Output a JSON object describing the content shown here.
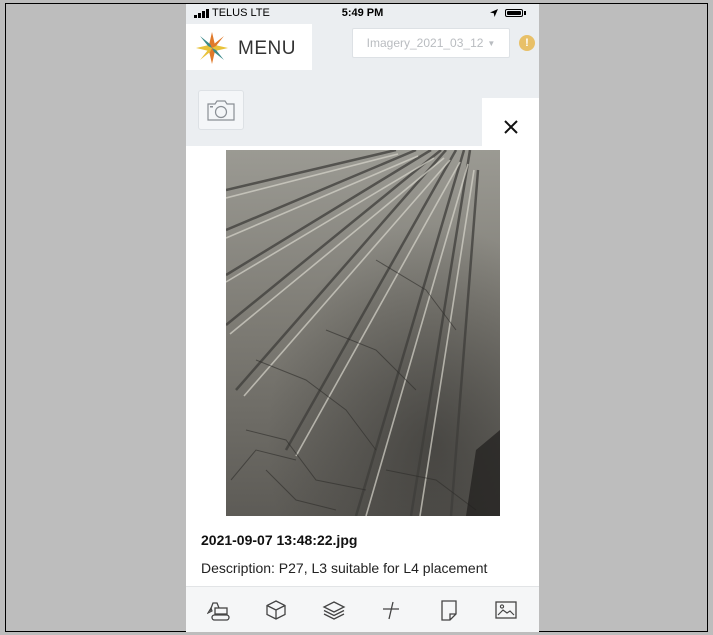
{
  "status_bar": {
    "carrier": "TELUS  LTE",
    "time": "5:49 PM"
  },
  "header": {
    "menu_label": "MENU",
    "imagery_select": "Imagery_2021_03_12",
    "alert_symbol": "!"
  },
  "photo_modal": {
    "close_symbol": "✕",
    "filename": "2021-09-07 13:48:22.jpg",
    "description": "Description: P27, L3 suitable for L4 placement"
  },
  "toolbar": {
    "items": [
      {
        "icon": "excavator-icon"
      },
      {
        "icon": "cube-icon"
      },
      {
        "icon": "layers-icon"
      },
      {
        "icon": "measure-icon"
      },
      {
        "icon": "note-icon"
      },
      {
        "icon": "image-icon"
      }
    ]
  },
  "colors": {
    "background": "#bdbdbd",
    "app_bg": "#ebeef1",
    "alert": "#e8c068",
    "logo_orange": "#e07a2a",
    "logo_yellow": "#e8c23a",
    "logo_teal": "#3a8a8a"
  }
}
